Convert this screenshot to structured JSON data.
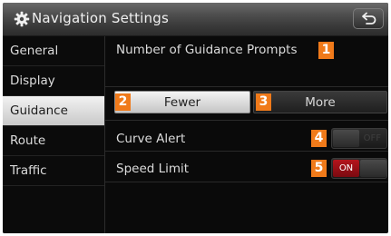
{
  "header": {
    "title": "Navigation Settings",
    "icon": "gear-icon",
    "back_icon": "back-arrow-icon"
  },
  "sidebar": {
    "items": [
      {
        "label": "General"
      },
      {
        "label": "Display"
      },
      {
        "label": "Guidance",
        "selected": true
      },
      {
        "label": "Route"
      },
      {
        "label": "Traffic"
      }
    ]
  },
  "content": {
    "prompts_label": "Number of Guidance Prompts",
    "fewer_label": "Fewer",
    "more_label": "More",
    "selected_prompt": "Fewer",
    "curve_alert_label": "Curve Alert",
    "curve_alert_state": "OFF",
    "speed_limit_label": "Speed Limit",
    "speed_limit_state": "ON"
  },
  "badges": [
    "1",
    "2",
    "3",
    "4",
    "5"
  ],
  "colors": {
    "badge": "#f07a1a",
    "on_toggle": "#b5141c",
    "selected_tab": "#e6e6e6"
  }
}
